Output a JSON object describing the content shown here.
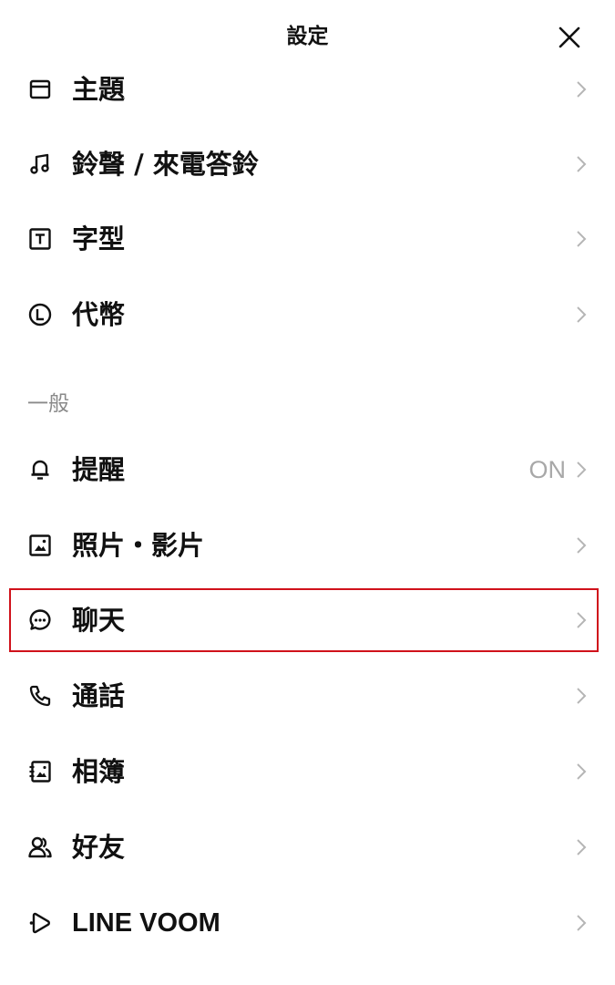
{
  "header": {
    "title": "設定"
  },
  "rows_top": [
    {
      "label": "主題",
      "icon": "theme-icon"
    },
    {
      "label": "鈴聲 / 來電答鈴",
      "icon": "music-note-icon"
    },
    {
      "label": "字型",
      "icon": "font-icon"
    },
    {
      "label": "代幣",
      "icon": "coin-icon"
    }
  ],
  "section": {
    "general_label": "一般"
  },
  "rows_general": [
    {
      "label": "提醒",
      "icon": "bell-icon",
      "value": "ON"
    },
    {
      "label": "照片・影片",
      "icon": "photo-icon"
    },
    {
      "label": "聊天",
      "icon": "chat-bubble-icon"
    },
    {
      "label": "通話",
      "icon": "phone-icon"
    },
    {
      "label": "相簿",
      "icon": "album-icon"
    },
    {
      "label": "好友",
      "icon": "friends-icon"
    },
    {
      "label": "LINE VOOM",
      "icon": "voom-icon"
    }
  ],
  "colors": {
    "highlight_border": "#d0121b",
    "secondary_text": "#a8a8a8",
    "section_text": "#8a8a8a"
  }
}
